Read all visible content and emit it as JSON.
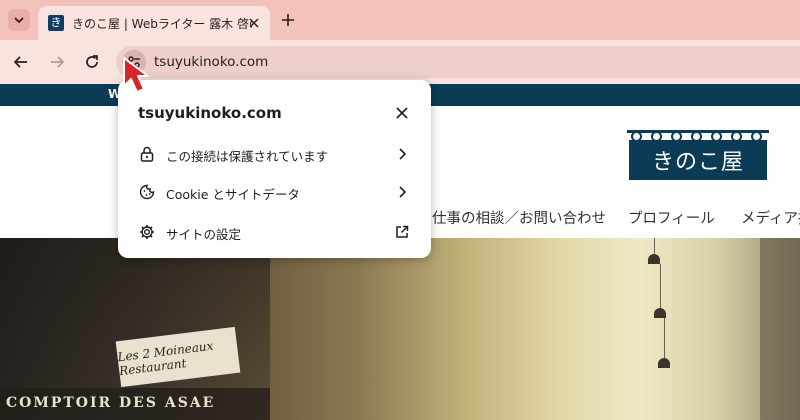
{
  "browser": {
    "tab": {
      "favicon_glyph": "き",
      "title": "きのこ屋 | Webライター 露木 啓のホ"
    },
    "address_bar": {
      "url": "tsuyukinoko.com"
    }
  },
  "page": {
    "topbar_text": "W",
    "logo_text": "きのこ屋",
    "nav": [
      {
        "label": "仕事の相談／お問い合わせ"
      },
      {
        "label": "プロフィール"
      },
      {
        "label": "メディア掲"
      }
    ],
    "hero": {
      "sign_text": "Les 2 Moineaux Restaurant",
      "awning_text": "COMPTOIR DES ASAE"
    }
  },
  "site_info_popup": {
    "title": "tsuyukinoko.com",
    "rows": [
      {
        "label": "この接続は保護されています",
        "icon": "lock-icon",
        "trailing": "chevron-right-icon"
      },
      {
        "label": "Cookie とサイトデータ",
        "icon": "cookie-icon",
        "trailing": "chevron-right-icon"
      },
      {
        "label": "サイトの設定",
        "icon": "gear-icon",
        "trailing": "open-external-icon"
      }
    ]
  },
  "colors": {
    "tabstrip": "#f3c2bb",
    "toolbar": "#f8e3df",
    "site_navy": "#0c3b56",
    "cursor_red": "#d7262c"
  }
}
